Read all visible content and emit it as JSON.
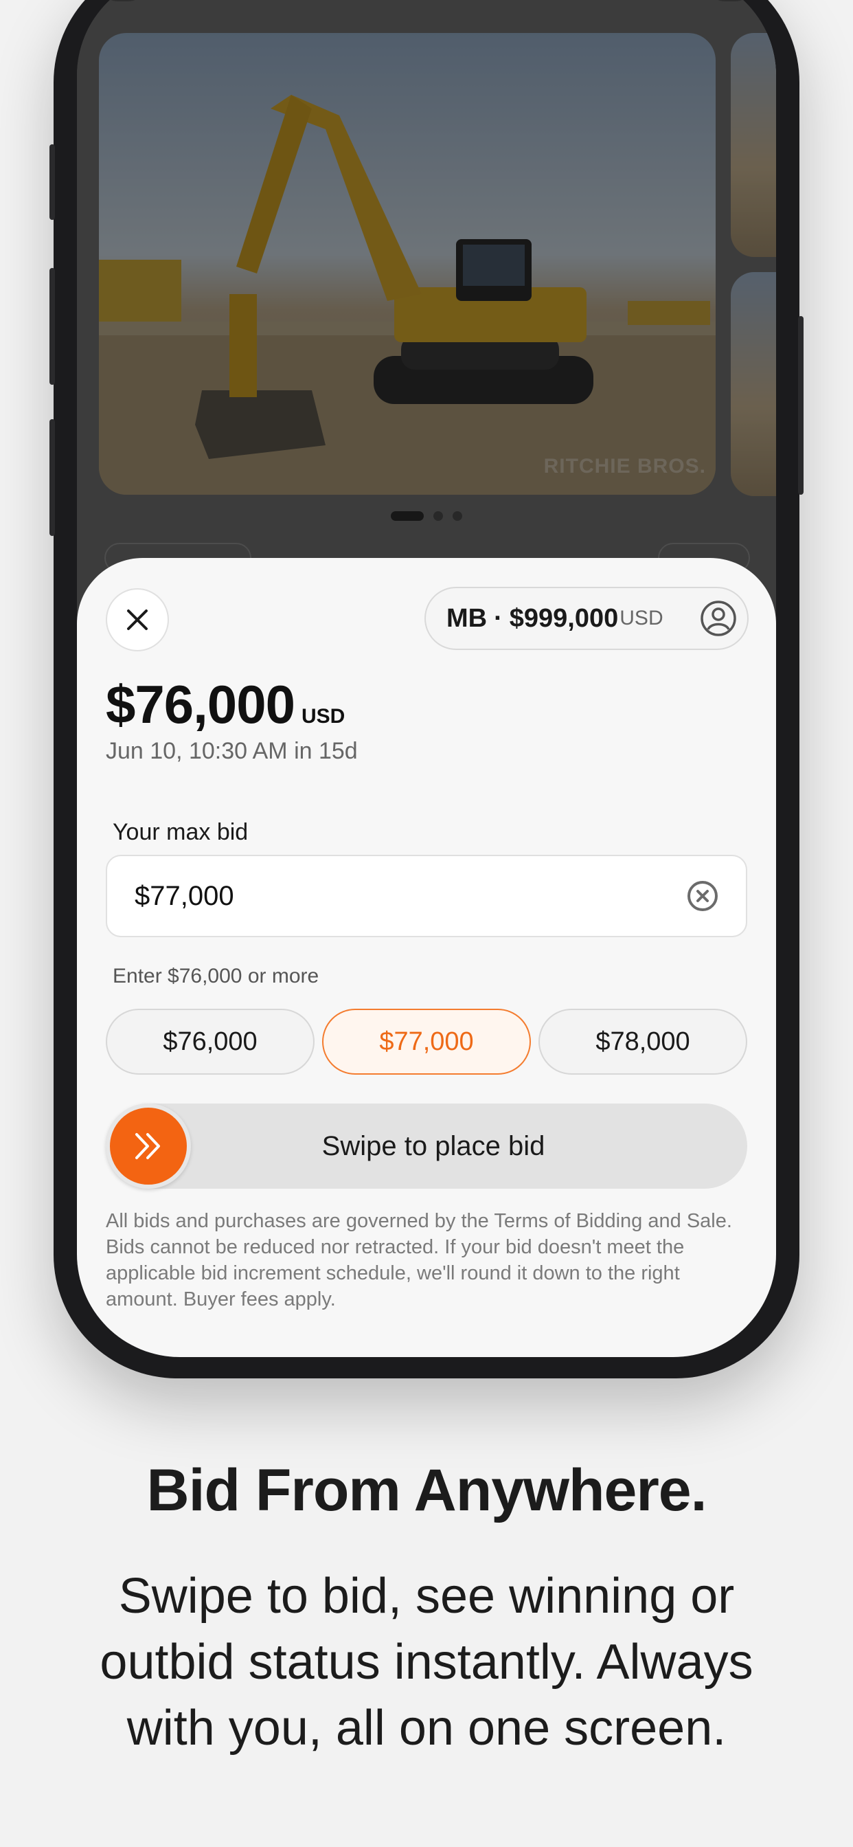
{
  "photo": {
    "watermark": "RITCHIE BROS."
  },
  "carousel": {
    "count": 3,
    "active_index": 0
  },
  "sheet": {
    "account": {
      "initials": "MB",
      "separator": "·",
      "amount": "$999,000",
      "currency": "USD"
    },
    "current_bid": {
      "amount": "$76,000",
      "currency": "USD"
    },
    "end_time": "Jun 10, 10:30 AM in 15d",
    "max_bid": {
      "label": "Your max bid",
      "value": "$77,000",
      "hint": "Enter $76,000 or more"
    },
    "quick_bids": [
      {
        "label": "$76,000",
        "selected": false
      },
      {
        "label": "$77,000",
        "selected": true
      },
      {
        "label": "$78,000",
        "selected": false
      }
    ],
    "swipe": {
      "label": "Swipe to place bid"
    },
    "terms": "All bids and purchases are governed by the Terms of Bidding and Sale.  Bids cannot be reduced nor retracted.  If your bid doesn't meet the applicable bid increment schedule, we'll round it down to the right amount.  Buyer fees apply."
  },
  "marketing": {
    "headline": "Bid From Anywhere.",
    "subcopy": "Swipe to bid, see winning or outbid status instantly. Always with you, all on one screen."
  },
  "colors": {
    "accent": "#f36412",
    "selected_text": "#ee6a17",
    "background": "#f2f2f2"
  },
  "icons": [
    "close-icon",
    "user-circle-icon",
    "clear-circle-icon",
    "double-chevron-right-icon"
  ]
}
